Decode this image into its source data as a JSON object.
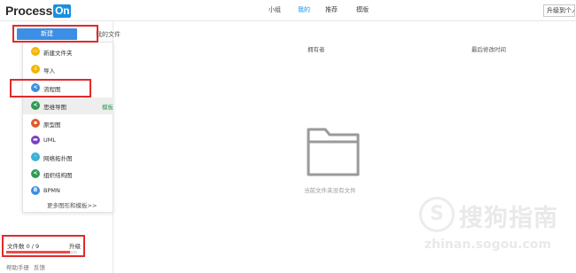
{
  "header": {
    "logo_text": "Process",
    "logo_badge": "On",
    "nav": [
      {
        "label": "小组",
        "active": false
      },
      {
        "label": "我的",
        "active": true
      },
      {
        "label": "推荐",
        "active": false
      },
      {
        "label": "模版",
        "active": false
      }
    ],
    "upgrade_label": "升级到个人"
  },
  "sidebar": {
    "new_button": "新建",
    "my_files": "我的文件",
    "file_count": "文件数 0 / 9",
    "upgrade": "升级",
    "quota_fraction": 0.9,
    "footer": [
      "帮助手册",
      "反馈"
    ]
  },
  "new_menu": {
    "items": [
      {
        "label": "新建文件夹",
        "icon": "folder-icon",
        "color": "#f5b400"
      },
      {
        "label": "导入",
        "icon": "import-icon",
        "color": "#f5b400"
      },
      {
        "label": "流程图",
        "icon": "flowchart-icon",
        "color": "#3b8fe4"
      },
      {
        "label": "思维导图",
        "icon": "mindmap-icon",
        "color": "#2e9b52",
        "template": "模板",
        "hover": true
      },
      {
        "label": "原型图",
        "icon": "prototype-icon",
        "color": "#e05a2b"
      },
      {
        "label": "UML",
        "icon": "uml-icon",
        "color": "#7a3fbf"
      },
      {
        "label": "网络拓扑图",
        "icon": "network-icon",
        "color": "#3bb0d9"
      },
      {
        "label": "组织结构图",
        "icon": "orgchart-icon",
        "color": "#2e9b52"
      },
      {
        "label": "BPMN",
        "icon": "bpmn-icon",
        "color": "#3b8fe4"
      }
    ],
    "more": "更多图形和模板>>"
  },
  "main": {
    "col_owner": "拥有者",
    "col_modified": "最后修改时间",
    "empty_text": "当前文件夹没有文件"
  },
  "watermark": {
    "brand": "搜狗指南",
    "url": "zhinan.sogou.com"
  },
  "colors": {
    "accent": "#3b8fe4",
    "highlight": "#e02b2b"
  }
}
